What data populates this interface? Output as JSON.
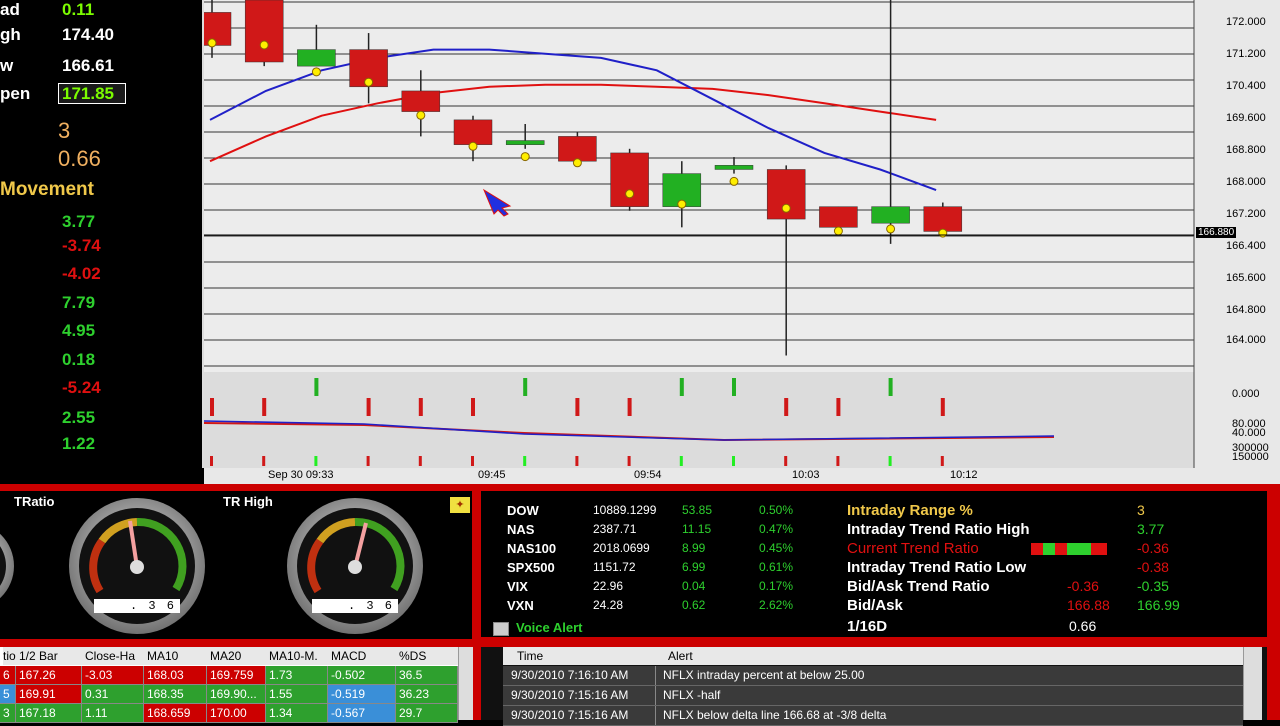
{
  "left_panel": {
    "stats": [
      {
        "label": "ad",
        "value": "0.11"
      },
      {
        "label": "gh",
        "value": "174.40"
      },
      {
        "label": "w",
        "value": "166.61"
      }
    ],
    "open_label": "pen",
    "open_value": "171.85",
    "count": "3",
    "ratio": "0.66",
    "movement_title": "Movement",
    "movements": [
      {
        "value": "3.77",
        "color": "#2ed02e"
      },
      {
        "value": "-3.74",
        "color": "#e01010"
      },
      {
        "value": "-4.02",
        "color": "#e01010"
      },
      {
        "value": "7.79",
        "color": "#2ed02e"
      },
      {
        "value": "4.95",
        "color": "#2ed02e"
      },
      {
        "value": "0.18",
        "color": "#2ed02e"
      },
      {
        "value": "-5.24",
        "color": "#e01010"
      },
      {
        "value": "2.55",
        "color": "#2ed02e"
      },
      {
        "value": "1.22",
        "color": "#2ed02e"
      }
    ]
  },
  "chart": {
    "price_axis": [
      "172.000",
      "171.200",
      "170.400",
      "169.600",
      "168.800",
      "168.000",
      "167.200",
      "166.400",
      "165.600",
      "164.800",
      "164.000"
    ],
    "current_price": "166.880",
    "indicator_axis": [
      "0.000",
      "80.000",
      "40.000",
      "300000",
      "150000"
    ],
    "time_labels": [
      "Sep 30 09:33",
      "09:45",
      "09:54",
      "10:03",
      "10:12"
    ]
  },
  "chart_data": {
    "type": "candlestick",
    "ylim": [
      163.6,
      172.6
    ],
    "x": [
      "09:33",
      "09:36",
      "09:39",
      "09:42",
      "09:45",
      "09:48",
      "09:51",
      "09:54",
      "09:57",
      "10:00",
      "10:03",
      "10:06",
      "10:09",
      "10:12",
      "10:15",
      "10:18"
    ],
    "candles": [
      {
        "open": 172.3,
        "close": 171.5,
        "high": 172.6,
        "low": 171.2
      },
      {
        "open": 172.6,
        "close": 171.1,
        "high": 172.6,
        "low": 171.0
      },
      {
        "open": 171.0,
        "close": 171.4,
        "high": 172.0,
        "low": 171.0
      },
      {
        "open": 171.4,
        "close": 170.5,
        "high": 171.8,
        "low": 170.1
      },
      {
        "open": 170.4,
        "close": 169.9,
        "high": 170.9,
        "low": 169.3
      },
      {
        "open": 169.7,
        "close": 169.1,
        "high": 169.8,
        "low": 168.7
      },
      {
        "open": 169.1,
        "close": 169.2,
        "high": 169.6,
        "low": 169.0
      },
      {
        "open": 169.3,
        "close": 168.7,
        "high": 169.4,
        "low": 168.6
      },
      {
        "open": 168.9,
        "close": 167.6,
        "high": 169.0,
        "low": 167.5
      },
      {
        "open": 167.6,
        "close": 168.4,
        "high": 168.7,
        "low": 167.1
      },
      {
        "open": 168.5,
        "close": 168.6,
        "high": 168.8,
        "low": 168.4
      },
      {
        "open": 168.5,
        "close": 167.3,
        "high": 168.6,
        "low": 164.0
      },
      {
        "open": 167.6,
        "close": 167.1,
        "high": 167.6,
        "low": 167.0
      },
      {
        "open": 167.2,
        "close": 167.6,
        "high": 172.6,
        "low": 166.7
      },
      {
        "open": 167.6,
        "close": 167.0,
        "high": 167.7,
        "low": 167.0
      }
    ],
    "ma_blue": [
      169.7,
      170.4,
      170.9,
      171.2,
      171.4,
      171.4,
      171.3,
      171.2,
      170.9,
      170.2,
      169.5,
      168.9,
      168.5,
      168.0
    ],
    "ma_red": [
      168.7,
      169.3,
      169.8,
      170.1,
      170.35,
      170.5,
      170.55,
      170.55,
      170.5,
      170.45,
      170.3,
      170.1,
      169.9,
      169.7
    ]
  },
  "gauges": [
    {
      "title": "TRatio",
      "readout": ". 3 6"
    },
    {
      "title": "TR High",
      "readout": ". 3 6"
    }
  ],
  "markets": [
    {
      "symbol": "DOW",
      "value": "10889.1299",
      "change": "53.85",
      "pct": "0.50%"
    },
    {
      "symbol": "NAS",
      "value": "2387.71",
      "change": "11.15",
      "pct": "0.47%"
    },
    {
      "symbol": "NAS100",
      "value": "2018.0699",
      "change": "8.99",
      "pct": "0.45%"
    },
    {
      "symbol": "SPX500",
      "value": "1151.72",
      "change": "6.99",
      "pct": "0.61%"
    },
    {
      "symbol": "VIX",
      "value": "22.96",
      "change": "0.04",
      "pct": "0.17%"
    },
    {
      "symbol": "VXN",
      "value": "24.28",
      "change": "0.62",
      "pct": "2.62%"
    }
  ],
  "voice_alert_label": "Voice Alert",
  "intraday": {
    "range_label": "Intraday Range %",
    "range_value": "3",
    "high_label": "Intraday Trend Ratio High",
    "high_value": "3.77",
    "current_label": "Current Trend Ratio",
    "current_value": "-0.36",
    "low_label": "Intraday Trend Ratio Low",
    "low_value": "-0.38",
    "bidask_ratio_label": "Bid/Ask Trend Ratio",
    "bidask_ratio_v1": "-0.36",
    "bidask_ratio_v2": "-0.35",
    "bidask_label": "Bid/Ask",
    "bid": "166.88",
    "ask": "166.99",
    "sixteenth_label": "1/16D",
    "sixteenth_value": "0.66"
  },
  "left_table": {
    "headers": [
      "tio",
      "1/2 Bar",
      "Close-Ha",
      "MA10",
      "MA20",
      "MA10-M.",
      "MACD",
      "%DS"
    ],
    "rows": [
      [
        "6",
        "167.26",
        "-3.03",
        "168.03",
        "169.759",
        "1.73",
        "-0.502",
        "36.5"
      ],
      [
        "5",
        "169.91",
        "0.31",
        "168.35",
        "169.90...",
        "1.55",
        "-0.519",
        "36.23"
      ],
      [
        "3",
        "167.18",
        "1.11",
        "168.659",
        "170.00",
        "1.34",
        "-0.567",
        "29.7"
      ]
    ]
  },
  "alerts": {
    "headers": [
      "Time",
      "Alert"
    ],
    "rows": [
      [
        "9/30/2010 7:16:10 AM",
        "NFLX intraday percent at below 25.00"
      ],
      [
        "9/30/2010 7:15:16 AM",
        "NFLX -half"
      ],
      [
        "9/30/2010 7:15:16 AM",
        "NFLX below delta line 166.68 at -3/8 delta"
      ]
    ]
  }
}
